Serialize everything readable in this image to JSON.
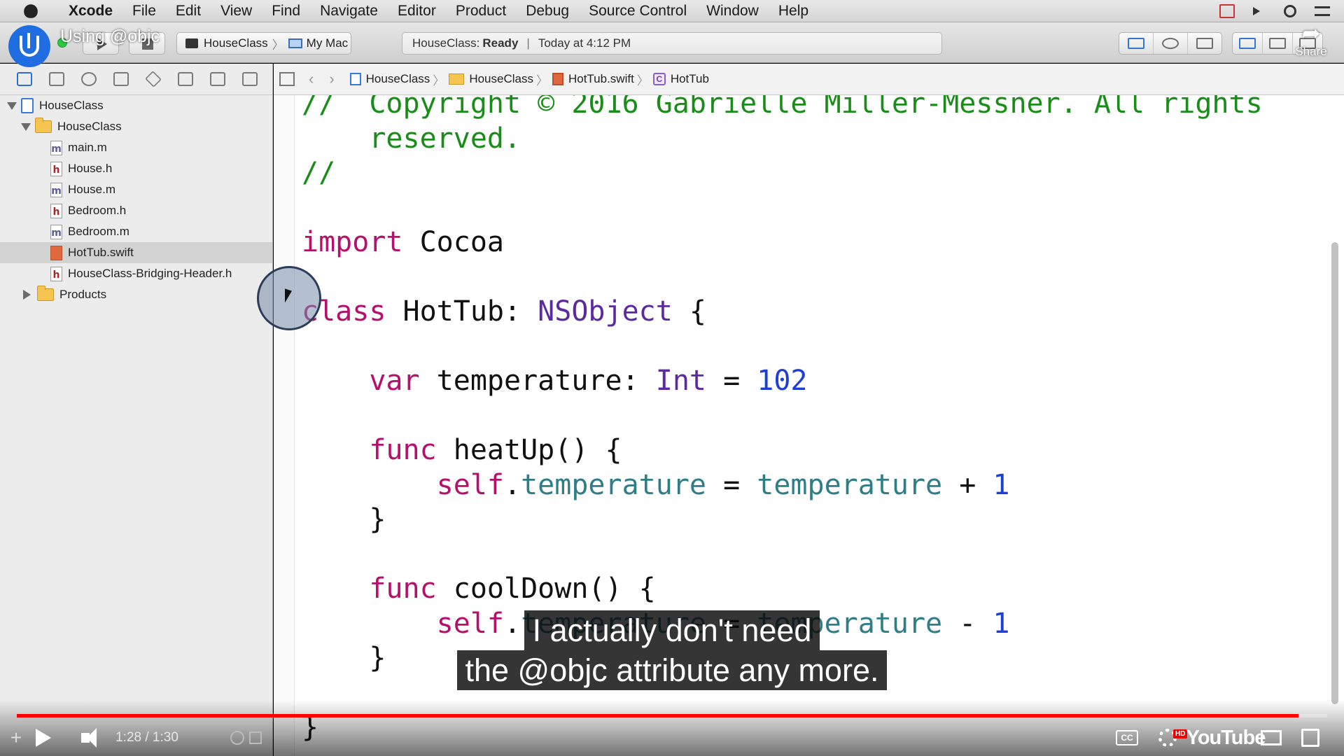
{
  "menubar": {
    "app": "Xcode",
    "items": [
      "File",
      "Edit",
      "View",
      "Find",
      "Navigate",
      "Editor",
      "Product",
      "Debug",
      "Source Control",
      "Window",
      "Help"
    ]
  },
  "video": {
    "title": "Using @objc",
    "share_label": "Share",
    "time": "1:28 / 1:30",
    "progress": 0.978,
    "brand": "YouTube",
    "subtitles": [
      "I actually don't need",
      "the @objc attribute any more."
    ]
  },
  "toolbar": {
    "scheme": "HouseClass",
    "destination": "My Mac",
    "status_project": "HouseClass:",
    "status_state": "Ready",
    "status_time": "Today at 4:12 PM"
  },
  "navigator": {
    "project": "HouseClass",
    "group": "HouseClass",
    "files": [
      {
        "name": "main.m",
        "kind": "m"
      },
      {
        "name": "House.h",
        "kind": "h"
      },
      {
        "name": "House.m",
        "kind": "m"
      },
      {
        "name": "Bedroom.h",
        "kind": "h"
      },
      {
        "name": "Bedroom.m",
        "kind": "m"
      },
      {
        "name": "HotTub.swift",
        "kind": "swift",
        "selected": true
      },
      {
        "name": "HouseClass-Bridging-Header.h",
        "kind": "h"
      }
    ],
    "products": "Products"
  },
  "jumpbar": {
    "crumbs": [
      "HouseClass",
      "HouseClass",
      "HotTub.swift",
      "HotTub"
    ]
  },
  "editor": {
    "lines": [
      {
        "tokens": [
          [
            "cm",
            "//  Copyright © 2016 Gabrielle Miller-Messner. All rights"
          ]
        ]
      },
      {
        "tokens": [
          [
            "cm",
            "    reserved."
          ]
        ]
      },
      {
        "tokens": [
          [
            "cm",
            "//"
          ]
        ]
      },
      {
        "tokens": [
          [
            "",
            ""
          ]
        ]
      },
      {
        "tokens": [
          [
            "kw",
            "import"
          ],
          [
            "",
            " Cocoa"
          ]
        ]
      },
      {
        "tokens": [
          [
            "",
            ""
          ]
        ]
      },
      {
        "tokens": [
          [
            "kw",
            "class"
          ],
          [
            "",
            " HotTub: "
          ],
          [
            "ty",
            "NSObject"
          ],
          [
            "",
            " {"
          ]
        ]
      },
      {
        "tokens": [
          [
            "",
            ""
          ]
        ]
      },
      {
        "tokens": [
          [
            "",
            "    "
          ],
          [
            "kw",
            "var"
          ],
          [
            "",
            " temperature: "
          ],
          [
            "ty",
            "Int"
          ],
          [
            "",
            " = "
          ],
          [
            "num",
            "102"
          ]
        ]
      },
      {
        "tokens": [
          [
            "",
            ""
          ]
        ]
      },
      {
        "tokens": [
          [
            "",
            "    "
          ],
          [
            "kw",
            "func"
          ],
          [
            "",
            " heatUp() {"
          ]
        ]
      },
      {
        "tokens": [
          [
            "",
            "        "
          ],
          [
            "kw",
            "self"
          ],
          [
            "",
            "."
          ],
          [
            "prop",
            "temperature"
          ],
          [
            "",
            " = "
          ],
          [
            "prop",
            "temperature"
          ],
          [
            "",
            " + "
          ],
          [
            "num",
            "1"
          ]
        ]
      },
      {
        "tokens": [
          [
            "",
            "    }"
          ]
        ]
      },
      {
        "tokens": [
          [
            "",
            ""
          ]
        ]
      },
      {
        "tokens": [
          [
            "",
            "    "
          ],
          [
            "kw",
            "func"
          ],
          [
            "",
            " coolDown() {"
          ]
        ]
      },
      {
        "tokens": [
          [
            "",
            "        "
          ],
          [
            "kw",
            "self"
          ],
          [
            "",
            "."
          ],
          [
            "prop",
            "temperature"
          ],
          [
            "",
            " = "
          ],
          [
            "prop",
            "temperature"
          ],
          [
            "",
            " - "
          ],
          [
            "num",
            "1"
          ]
        ]
      },
      {
        "tokens": [
          [
            "",
            "    }"
          ]
        ]
      },
      {
        "tokens": [
          [
            "",
            ""
          ]
        ]
      },
      {
        "tokens": [
          [
            "",
            "}"
          ]
        ]
      }
    ]
  }
}
